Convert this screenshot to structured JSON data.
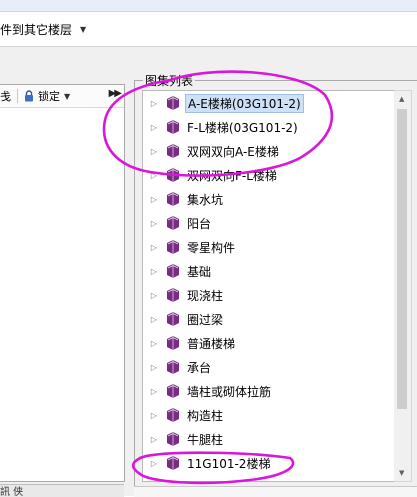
{
  "toolbar": {
    "copy_label": "件到其它楼层"
  },
  "left_panel": {
    "truncated_text": "戋",
    "lock_label": "锁定",
    "bottom_text": "訊  侠"
  },
  "atlas_list": {
    "title": "图集列表",
    "items": [
      {
        "label": "A-E楼梯(03G101-2)",
        "selected": true
      },
      {
        "label": "F-L楼梯(03G101-2)"
      },
      {
        "label": "双网双向A-E楼梯"
      },
      {
        "label": "双网双向F-L楼梯"
      },
      {
        "label": "集水坑"
      },
      {
        "label": "阳台"
      },
      {
        "label": "零星构件"
      },
      {
        "label": "基础"
      },
      {
        "label": "现浇柱"
      },
      {
        "label": "圈过梁"
      },
      {
        "label": "普通楼梯"
      },
      {
        "label": "承台"
      },
      {
        "label": "墙柱或砌体拉筋"
      },
      {
        "label": "构造柱"
      },
      {
        "label": "牛腿柱"
      },
      {
        "label": "11G101-2楼梯"
      }
    ]
  },
  "colors": {
    "annotation": "#d916d9",
    "book_icon": "#7a2c82",
    "selection": "#cde0f5"
  },
  "icons": {
    "expand": "triangle-right-icon",
    "item": "book-icon",
    "lock": "padlock-icon"
  }
}
